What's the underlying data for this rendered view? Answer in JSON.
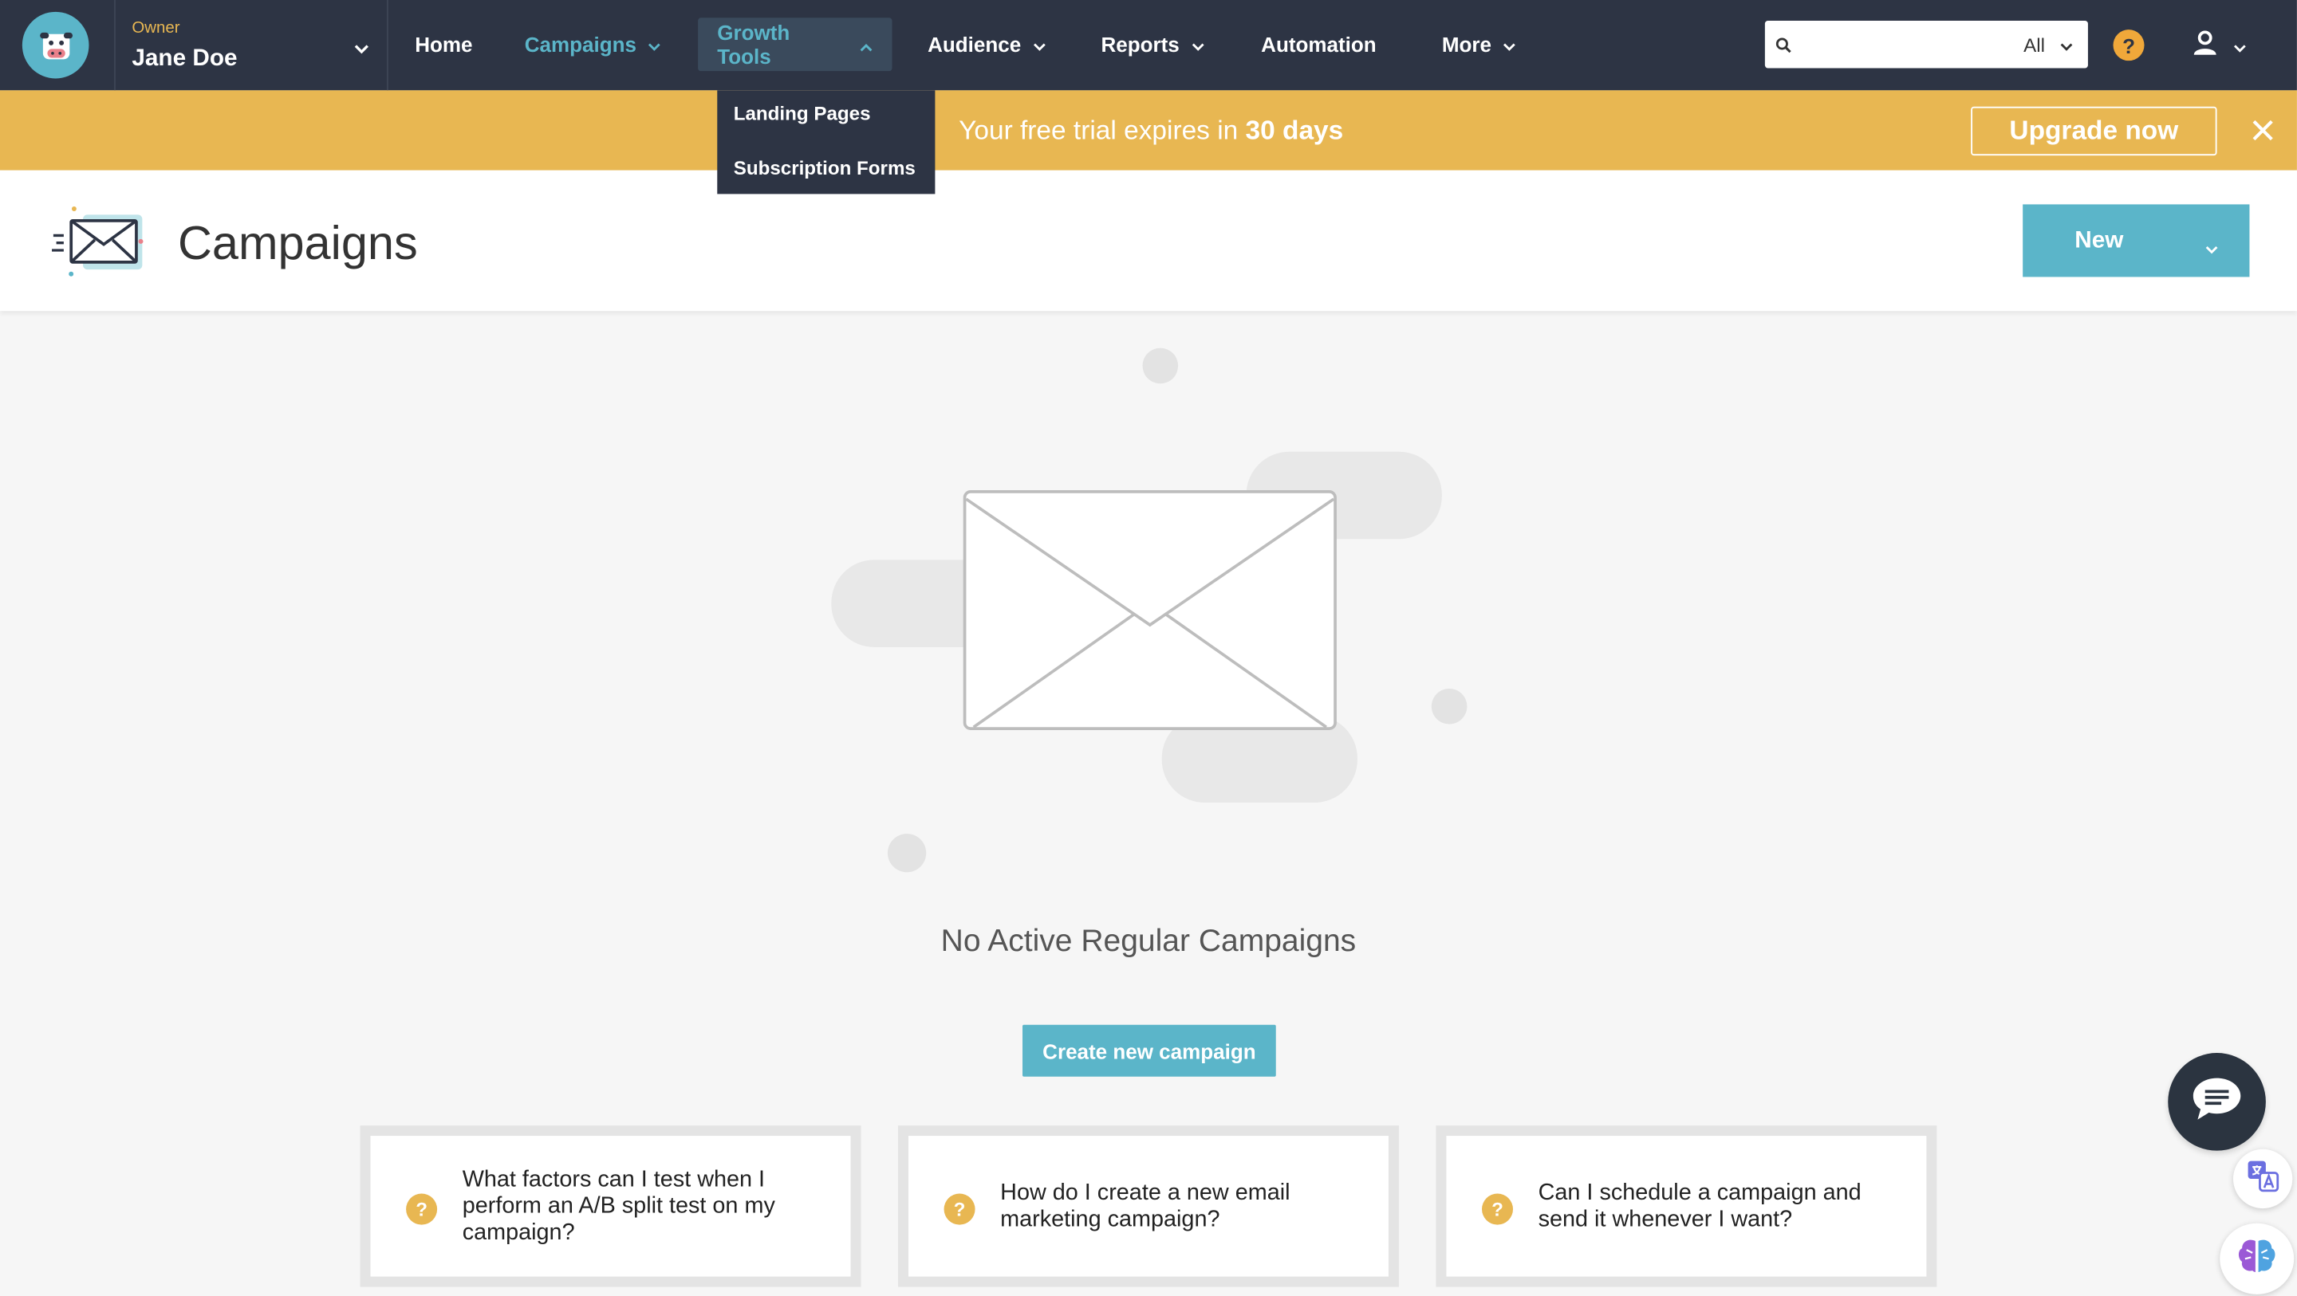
{
  "account": {
    "role": "Owner",
    "name": "Jane Doe"
  },
  "nav": {
    "home": "Home",
    "campaigns": "Campaigns",
    "growth_tools": "Growth Tools",
    "audience": "Audience",
    "reports": "Reports",
    "automation": "Automation",
    "more": "More"
  },
  "growth_menu": [
    "Landing Pages",
    "Subscription Forms"
  ],
  "search": {
    "placeholder": "",
    "scope": "All"
  },
  "help_glyph": "?",
  "trial": {
    "prefix": "Your free trial expires in ",
    "days": "30 days",
    "upgrade": "Upgrade now"
  },
  "page": {
    "title": "Campaigns",
    "new_button": "New"
  },
  "empty_state": {
    "title": "No Active Regular Campaigns",
    "cta": "Create new campaign"
  },
  "faq": [
    {
      "icon": "?",
      "question": "What factors can I test when I perform an A/B split test on my campaign?"
    },
    {
      "icon": "?",
      "question": "How do I create a new email marketing campaign?"
    },
    {
      "icon": "?",
      "question": "Can I schedule a campaign and send it whenever I want?"
    }
  ],
  "colors": {
    "nav_bg": "#2d3444",
    "accent": "#5bb5c9",
    "banner": "#e8b752",
    "help": "#f0a83a"
  },
  "icons": [
    "logo-icon",
    "chevron-down-icon",
    "chevron-up-icon",
    "search-icon",
    "help-icon",
    "user-icon",
    "close-icon",
    "campaign-envelope-icon",
    "question-icon",
    "chat-icon",
    "translate-icon",
    "brain-icon"
  ]
}
